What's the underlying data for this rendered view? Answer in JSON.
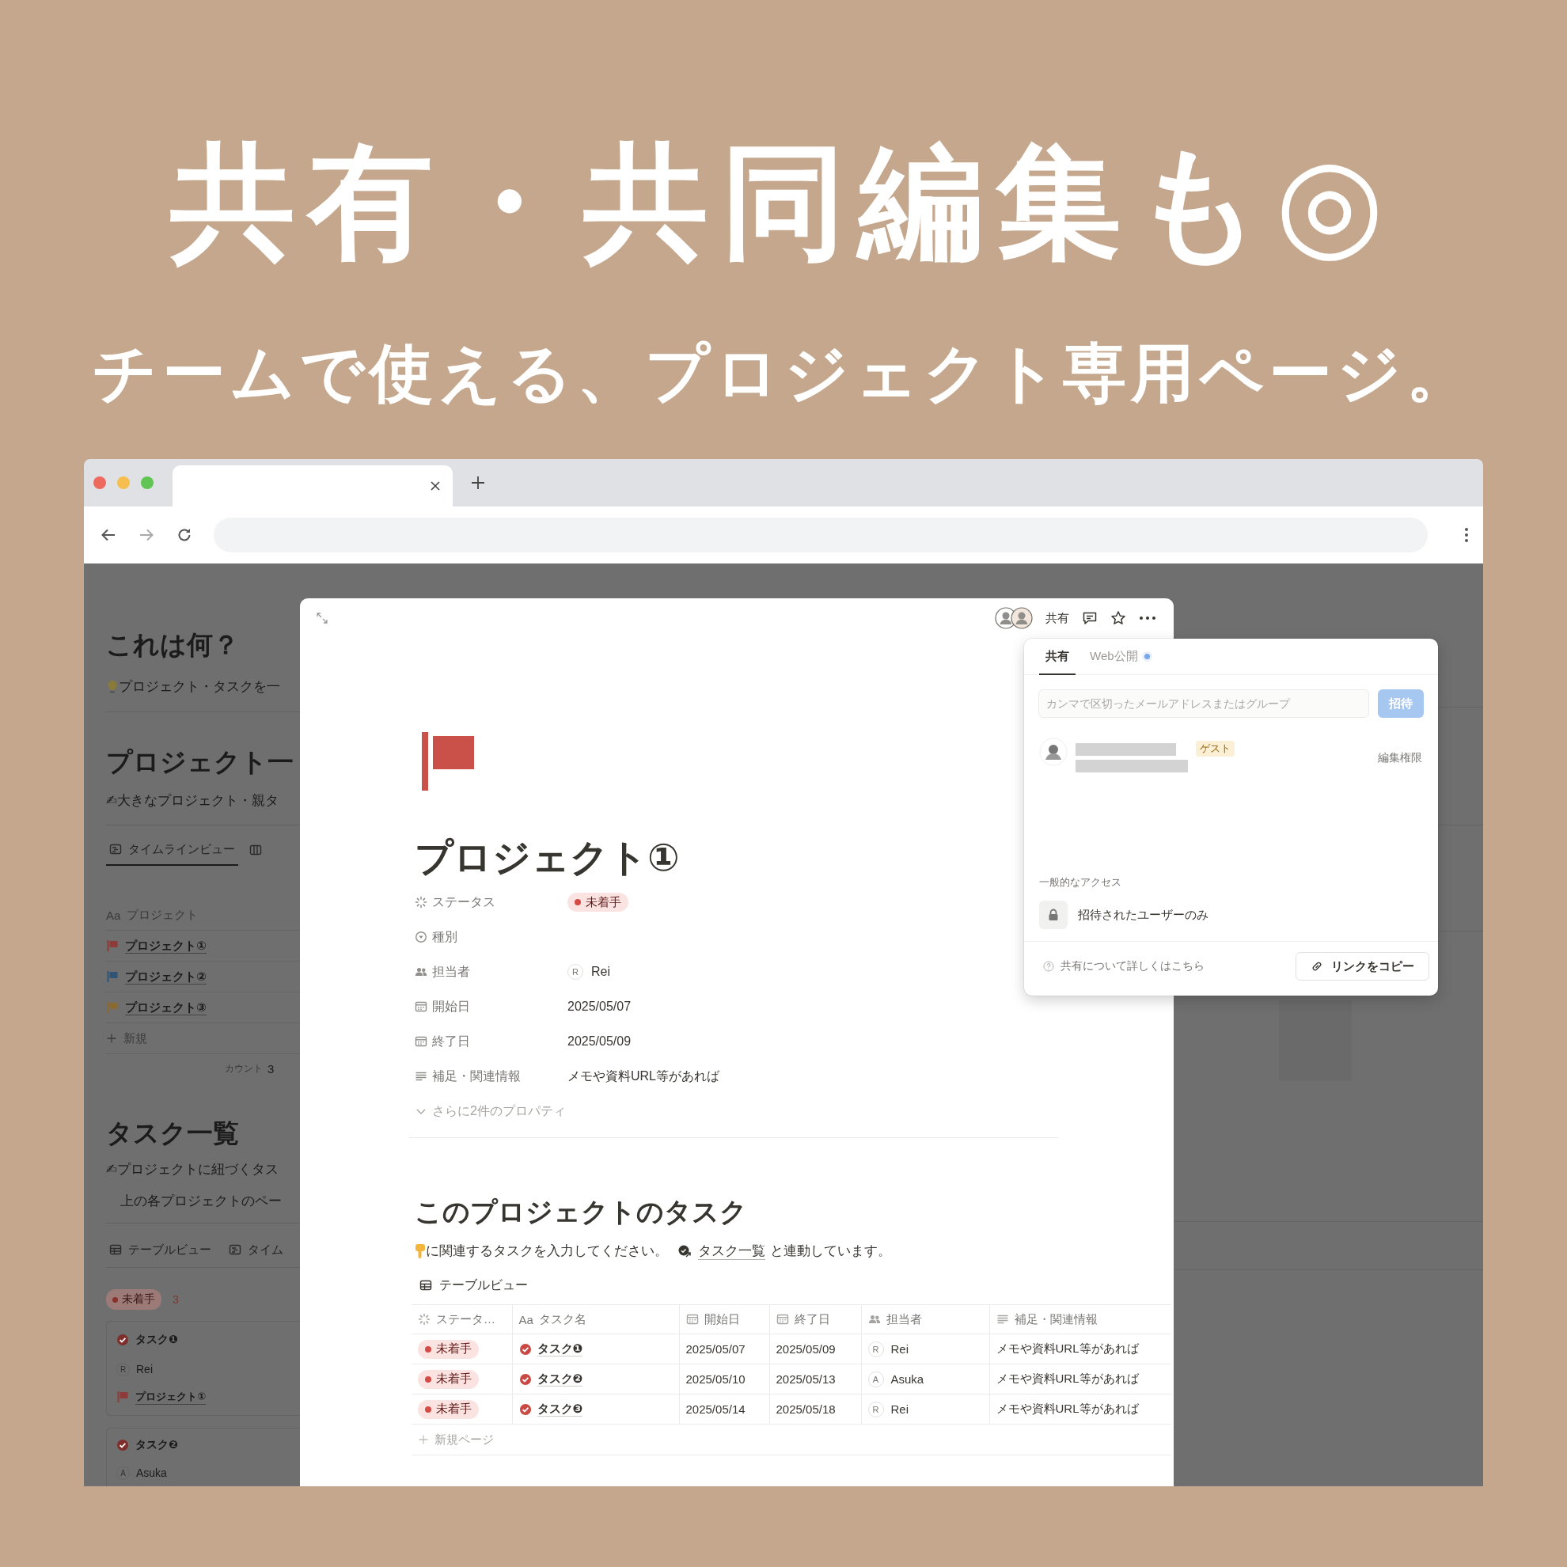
{
  "hero": {
    "title": "共有・共同編集も◎",
    "subtitle": "チームで使える、プロジェクト専用ページ。"
  },
  "background_page": {
    "intro": {
      "heading": "これは何？",
      "text": "プロジェクト・タスクを一"
    },
    "projects": {
      "heading": "プロジェクト一",
      "text": "✍大きなプロジェクト・親タ",
      "views": [
        {
          "kind": "timeline",
          "label": "タイムラインビュー",
          "selected": true
        },
        {
          "kind": "board",
          "selected": false
        }
      ],
      "table": {
        "column_prefix": "Aa",
        "column": "プロジェクト",
        "rows": [
          {
            "name": "プロジェクト①",
            "color": "#8e3b37"
          },
          {
            "name": "プロジェクト②",
            "color": "#2f5476"
          },
          {
            "name": "プロジェクト③",
            "color": "#8a6a30"
          }
        ],
        "new_label": "新規",
        "count_label": "カウント",
        "count": "3"
      }
    },
    "tasks": {
      "heading": "タスク一覧",
      "lines": [
        "✍プロジェクトに紐づくタス",
        "上の各プロジェクトのペー"
      ],
      "views": [
        {
          "kind": "table",
          "label": "テーブルビュー"
        },
        {
          "kind": "timeline",
          "label": "タイム"
        }
      ],
      "group": {
        "status": "未着手",
        "count": "3"
      },
      "cards": [
        {
          "title": "タスク❶",
          "initial": "R",
          "assignee": "Rei",
          "project": "プロジェクト①"
        },
        {
          "title": "タスク❷",
          "initial": "A",
          "assignee": "Asuka"
        }
      ]
    }
  },
  "modal": {
    "share_label": "共有",
    "title": "プロジェクト①",
    "properties": [
      {
        "kind": "status",
        "label": "ステータス",
        "value": "未着手"
      },
      {
        "kind": "select",
        "label": "種別"
      },
      {
        "kind": "person",
        "label": "担当者",
        "initial": "R",
        "value": "Rei"
      },
      {
        "kind": "date",
        "label": "開始日",
        "value": "2025/05/07"
      },
      {
        "kind": "date",
        "label": "終了日",
        "value": "2025/05/09"
      },
      {
        "kind": "text",
        "label": "補足・関連情報",
        "value": "メモや資料URL等があれば"
      }
    ],
    "more_properties": "さらに2件のプロパティ",
    "tasks": {
      "heading": "このプロジェクトのタスク",
      "note_before": "に関連するタスクを入力してください。",
      "link": "タスク一覧",
      "note_after": "と連動しています。",
      "view": "テーブルビュー",
      "columns": [
        {
          "kind": "status",
          "label": "ステータ…"
        },
        {
          "kind": "title",
          "prefix": "Aa",
          "label": "タスク名"
        },
        {
          "kind": "date",
          "label": "開始日"
        },
        {
          "kind": "date",
          "label": "終了日"
        },
        {
          "kind": "person",
          "label": "担当者"
        },
        {
          "kind": "text",
          "label": "補足・関連情報"
        }
      ],
      "rows": [
        {
          "status": "未着手",
          "name": "タスク❶",
          "start": "2025/05/07",
          "end": "2025/05/09",
          "initial": "R",
          "assignee": "Rei",
          "note": "メモや資料URL等があれば"
        },
        {
          "status": "未着手",
          "name": "タスク❷",
          "start": "2025/05/10",
          "end": "2025/05/13",
          "initial": "A",
          "assignee": "Asuka",
          "note": "メモや資料URL等があれば"
        },
        {
          "status": "未着手",
          "name": "タスク❸",
          "start": "2025/05/14",
          "end": "2025/05/18",
          "initial": "R",
          "assignee": "Rei",
          "note": "メモや資料URL等があれば"
        }
      ],
      "new_row": "新規ページ"
    }
  },
  "share_popup": {
    "tabs": [
      {
        "label": "共有",
        "selected": true,
        "dot": false
      },
      {
        "label": "Web公開",
        "selected": false,
        "dot": true
      }
    ],
    "invite_placeholder": "カンマで区切ったメールアドレスまたはグループ",
    "invite_button": "招待",
    "member": {
      "badge": "ゲスト",
      "role": "編集権限"
    },
    "access_heading": "一般的なアクセス",
    "access": "招待されたユーザーのみ",
    "help": "共有について詳しくはこちら",
    "copy_link": "リンクをコピー"
  }
}
